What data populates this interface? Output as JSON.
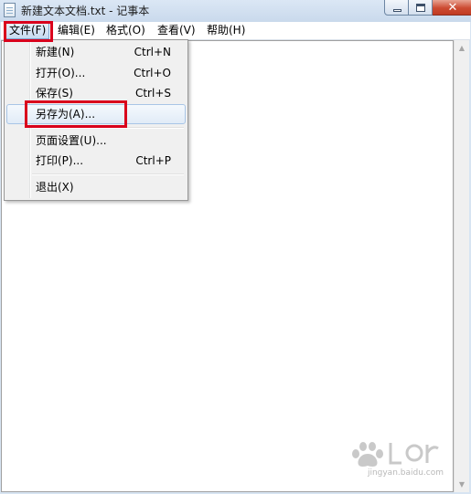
{
  "window": {
    "title": "新建文本文档.txt - 记事本",
    "icon": "notepad-icon",
    "caption_buttons": {
      "minimize_icon": "minimize-icon",
      "maximize_icon": "maximize-icon",
      "close_icon": "close-icon",
      "close_glyph": "✕",
      "close_color": "#c13b22"
    }
  },
  "menubar": {
    "items": [
      {
        "label": "文件(F)",
        "active": true
      },
      {
        "label": "编辑(E)"
      },
      {
        "label": "格式(O)"
      },
      {
        "label": "查看(V)"
      },
      {
        "label": "帮助(H)"
      }
    ]
  },
  "file_menu": {
    "items": [
      {
        "label": "新建(N)",
        "shortcut": "Ctrl+N"
      },
      {
        "label": "打开(O)...",
        "shortcut": "Ctrl+O"
      },
      {
        "label": "保存(S)",
        "shortcut": "Ctrl+S"
      },
      {
        "label": "另存为(A)...",
        "shortcut": "",
        "hover": true
      },
      {
        "label": "页面设置(U)...",
        "shortcut": ""
      },
      {
        "label": "打印(P)...",
        "shortcut": "Ctrl+P"
      },
      {
        "label": "退出(X)",
        "shortcut": ""
      }
    ]
  },
  "editor": {
    "content": ""
  },
  "scrollbar": {
    "up_glyph": "▲",
    "down_glyph": "▼"
  },
  "annotations": {
    "color": "#d9001c"
  },
  "watermark": {
    "logo": "baidu-jingyan-logo",
    "text": "jingyan.baidu.com"
  }
}
